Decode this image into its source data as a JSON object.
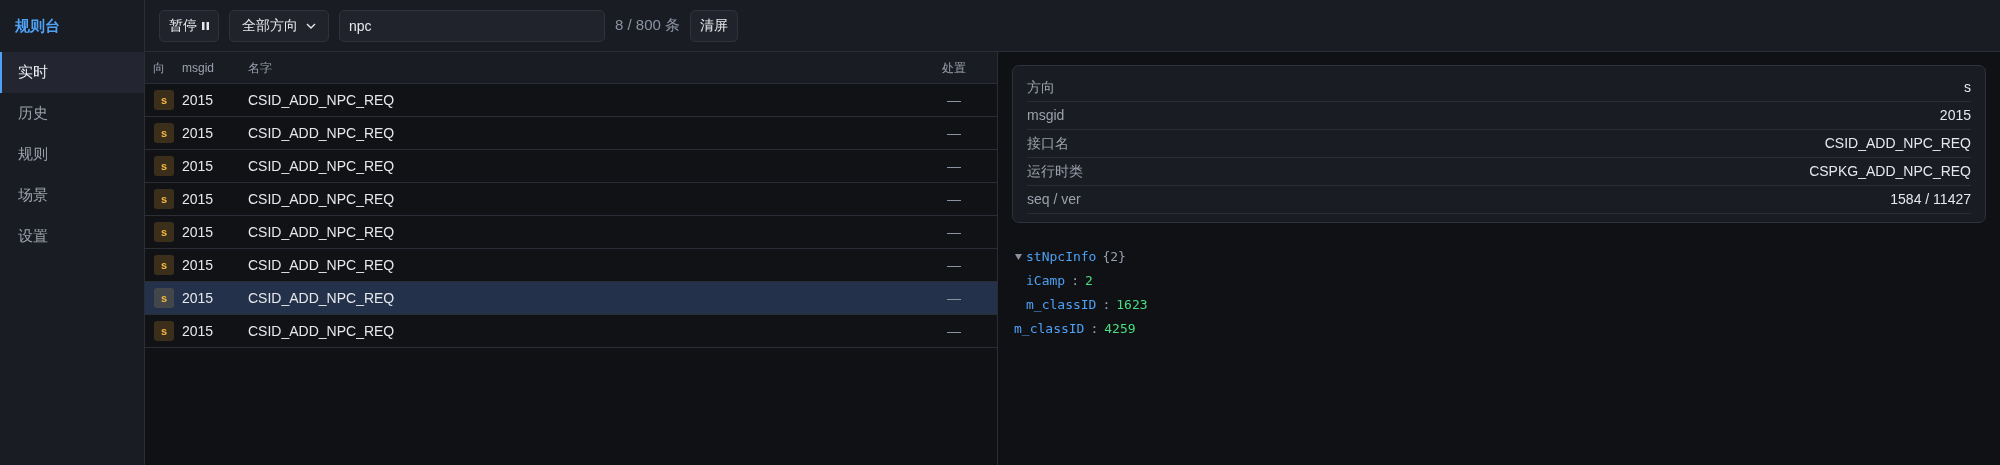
{
  "sidebar": {
    "title": "规则台",
    "items": [
      {
        "label": "实时",
        "selected": true
      },
      {
        "label": "历史",
        "selected": false
      },
      {
        "label": "规则",
        "selected": false
      },
      {
        "label": "场景",
        "selected": false
      },
      {
        "label": "设置",
        "selected": false
      }
    ]
  },
  "toolbar": {
    "pause_button": "暂停",
    "direction_select": "全部方向",
    "search": {
      "value": "npc"
    },
    "count": "8 / 800 条",
    "clear_button": "清屏"
  },
  "table": {
    "columns": [
      "向",
      "msgid",
      "名字",
      "处置"
    ],
    "rows": [
      {
        "direction": "s",
        "msgid": "2015",
        "name": "CSID_ADD_NPC_REQ",
        "action": "—",
        "selected": false
      },
      {
        "direction": "s",
        "msgid": "2015",
        "name": "CSID_ADD_NPC_REQ",
        "action": "—",
        "selected": false
      },
      {
        "direction": "s",
        "msgid": "2015",
        "name": "CSID_ADD_NPC_REQ",
        "action": "—",
        "selected": false
      },
      {
        "direction": "s",
        "msgid": "2015",
        "name": "CSID_ADD_NPC_REQ",
        "action": "—",
        "selected": false
      },
      {
        "direction": "s",
        "msgid": "2015",
        "name": "CSID_ADD_NPC_REQ",
        "action": "—",
        "selected": false
      },
      {
        "direction": "s",
        "msgid": "2015",
        "name": "CSID_ADD_NPC_REQ",
        "action": "—",
        "selected": false
      },
      {
        "direction": "s",
        "msgid": "2015",
        "name": "CSID_ADD_NPC_REQ",
        "action": "—",
        "selected": true
      },
      {
        "direction": "s",
        "msgid": "2015",
        "name": "CSID_ADD_NPC_REQ",
        "action": "—",
        "selected": false
      }
    ]
  },
  "detail": {
    "fields": [
      {
        "label": "方向",
        "value": "s"
      },
      {
        "label": "msgid",
        "value": "2015"
      },
      {
        "label": "接口名",
        "value": "CSID_ADD_NPC_REQ"
      },
      {
        "label": "运行时类",
        "value": "CSPKG_ADD_NPC_REQ"
      },
      {
        "label": "seq / ver",
        "value": "1584 / 11427"
      }
    ],
    "tree": [
      {
        "key": "stNpcInfo",
        "summary": "{2}",
        "expanded": true,
        "children": [
          {
            "key": "iCamp",
            "separator": ":",
            "value": "2"
          },
          {
            "key": "m_classID",
            "separator": ":",
            "value": "1623"
          }
        ]
      },
      {
        "key": "m_classID",
        "separator": ":",
        "value": "4259"
      }
    ]
  }
}
